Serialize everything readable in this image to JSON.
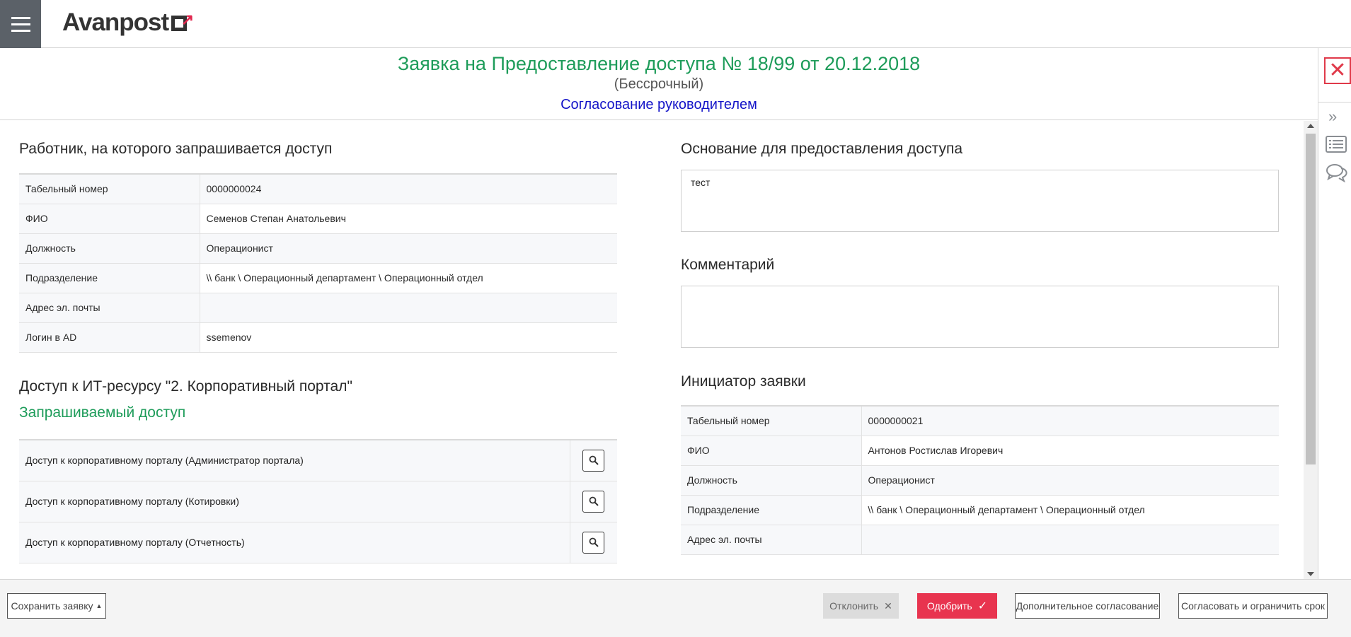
{
  "app": {
    "logo_text": "Avanpost"
  },
  "header": {
    "title": "Заявка на Предоставление доступа № 18/99 от 20.12.2018",
    "subtitle": "(Бессрочный)",
    "stage": "Согласование руководителем"
  },
  "employee": {
    "section_title": "Работник, на которого запрашивается доступ",
    "rows": [
      {
        "label": "Табельный номер",
        "value": "0000000024"
      },
      {
        "label": "ФИО",
        "value": "Семенов Степан Анатольевич"
      },
      {
        "label": "Должность",
        "value": "Операционист"
      },
      {
        "label": "Подразделение",
        "value": "\\\\ банк \\ Операционный департамент \\ Операционный отдел"
      },
      {
        "label": "Адрес эл. почты",
        "value": ""
      },
      {
        "label": "Логин в AD",
        "value": "ssemenov"
      }
    ]
  },
  "resource": {
    "section_title": "Доступ к ИТ-ресурсу \"2. Корпоративный портал\"",
    "requested_title": "Запрашиваемый доступ",
    "items": [
      {
        "label": "Доступ к корпоративному порталу (Администратор портала)"
      },
      {
        "label": "Доступ к корпоративному порталу (Котировки)"
      },
      {
        "label": "Доступ к корпоративному порталу (Отчетность)"
      }
    ]
  },
  "basis": {
    "section_title": "Основание для предоставления доступа",
    "value": "тест"
  },
  "comment": {
    "section_title": "Комментарий",
    "value": ""
  },
  "initiator": {
    "section_title": "Инициатор заявки",
    "rows": [
      {
        "label": "Табельный номер",
        "value": "0000000021"
      },
      {
        "label": "ФИО",
        "value": "Антонов Ростислав Игоревич"
      },
      {
        "label": "Должность",
        "value": "Операционист"
      },
      {
        "label": "Подразделение",
        "value": "\\\\ банк \\ Операционный департамент \\ Операционный отдел"
      },
      {
        "label": "Адрес эл. почты",
        "value": ""
      }
    ]
  },
  "footer": {
    "save_label": "Сохранить заявку",
    "reject_label": "Отклонить",
    "approve_label": "Одобрить",
    "extra_approval_label": "Дополнительное согласование",
    "approve_limit_label": "Согласовать и ограничить срок"
  },
  "colors": {
    "accent_green": "#1e9c5a",
    "stage_blue": "#1414c8",
    "approve_red": "#e8344f",
    "close_red": "#e03a4a"
  }
}
